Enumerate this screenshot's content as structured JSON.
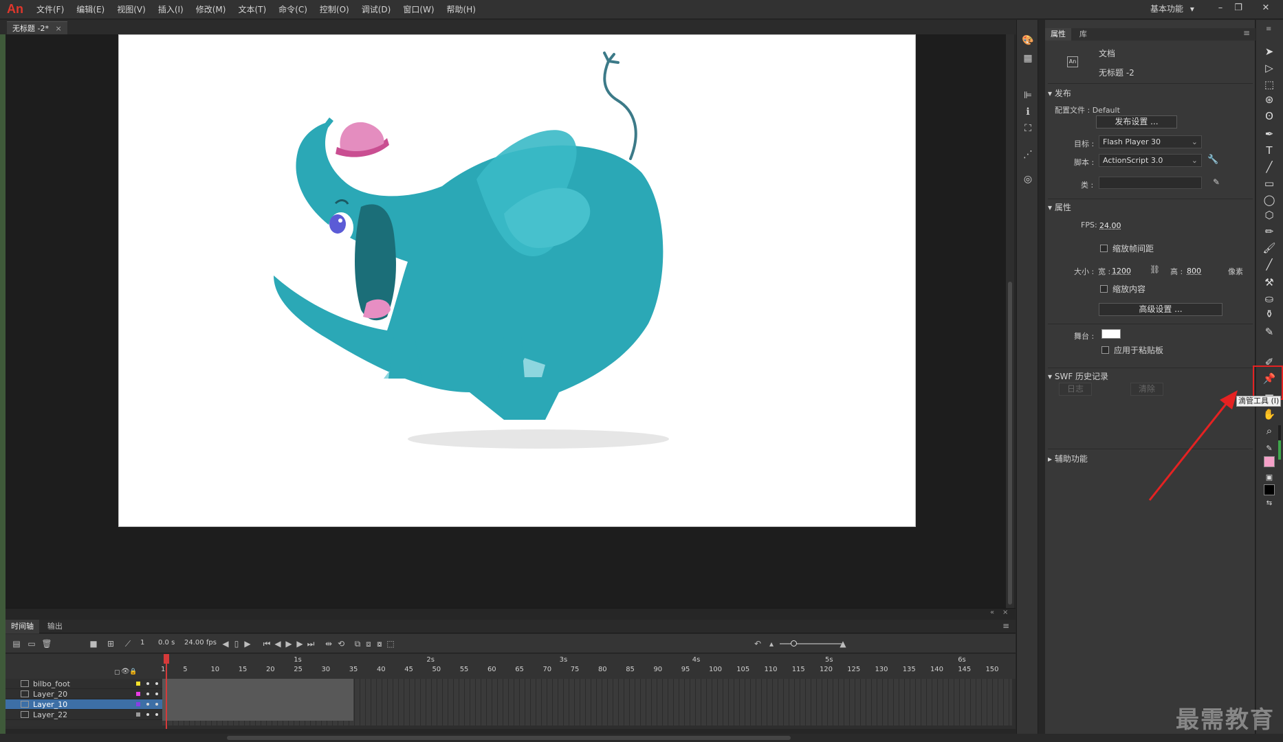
{
  "app": {
    "logo": "An"
  },
  "menu": [
    "文件(F)",
    "编辑(E)",
    "视图(V)",
    "插入(I)",
    "修改(M)",
    "文本(T)",
    "命令(C)",
    "控制(O)",
    "调试(D)",
    "窗口(W)",
    "帮助(H)"
  ],
  "workspace": {
    "label": "基本功能",
    "caret": "▾"
  },
  "window_controls": {
    "minimize": "–",
    "restore": "❐",
    "close": "✕"
  },
  "document": {
    "tab_title": "无标题 -2*",
    "tab_close": "×"
  },
  "timeline": {
    "tabs": [
      "时间轴",
      "输出"
    ],
    "current_frame": "1",
    "elapsed": "0.0 s",
    "fps": "24.00",
    "fps_unit": "fps",
    "time_marks": [
      "1s",
      "2s",
      "3s",
      "4s",
      "5s",
      "6s"
    ],
    "frame_numbers": [
      "1",
      "5",
      "10",
      "15",
      "20",
      "25",
      "30",
      "35",
      "40",
      "45",
      "50",
      "55",
      "60",
      "65",
      "70",
      "75",
      "80",
      "85",
      "90",
      "95",
      "100",
      "105",
      "110",
      "115",
      "120",
      "125",
      "130",
      "135",
      "140",
      "145",
      "150"
    ],
    "layers": [
      {
        "name": "bilbo_foot",
        "color": "#f5e12c",
        "selected": false
      },
      {
        "name": "Layer_20",
        "color": "#e83de6",
        "selected": false
      },
      {
        "name": "Layer_10",
        "color": "#8a3de6",
        "selected": true
      },
      {
        "name": "Layer_22",
        "color": "#9b9b9b",
        "selected": false
      }
    ]
  },
  "properties": {
    "tabs": [
      "属性",
      "库"
    ],
    "doc_type": "文档",
    "doc_name": "无标题 -2",
    "doc_icon_label": "An",
    "publish": {
      "section": "发布",
      "profile_label": "配置文件 :",
      "profile_value": "Default",
      "settings_button": "发布设置 ...",
      "target_label": "目标 :",
      "target_value": "Flash Player 30",
      "script_label": "脚本 :",
      "script_value": "ActionScript 3.0",
      "class_label": "类 :",
      "class_value": ""
    },
    "attributes": {
      "section": "属性",
      "fps_label": "FPS:",
      "fps_value": "24.00",
      "scale_spans_label": "缩放帧间距",
      "size_label": "大小 :",
      "width_label": "宽 :",
      "width_value": "1200",
      "height_label": "高 :",
      "height_value": "800",
      "unit": "像素",
      "scale_content_label": "缩放内容",
      "advanced_button": "高级设置 ...",
      "stage_label": "舞台 :",
      "stage_color": "#ffffff",
      "apply_pasteboard_label": "应用于粘贴板"
    },
    "swf_history": {
      "section": "SWF 历史记录",
      "log_button": "日志",
      "clear_button": "清除"
    },
    "accessibility": {
      "section": "辅助功能"
    }
  },
  "tools": {
    "highlighted": "eyedropper-icon",
    "tooltip": "滴管工具 (I)",
    "fill_color": "#f5a0c8",
    "stroke_color": "#000000"
  },
  "annotation": {
    "arrow_color": "#e52222"
  },
  "watermark": "最需教育"
}
